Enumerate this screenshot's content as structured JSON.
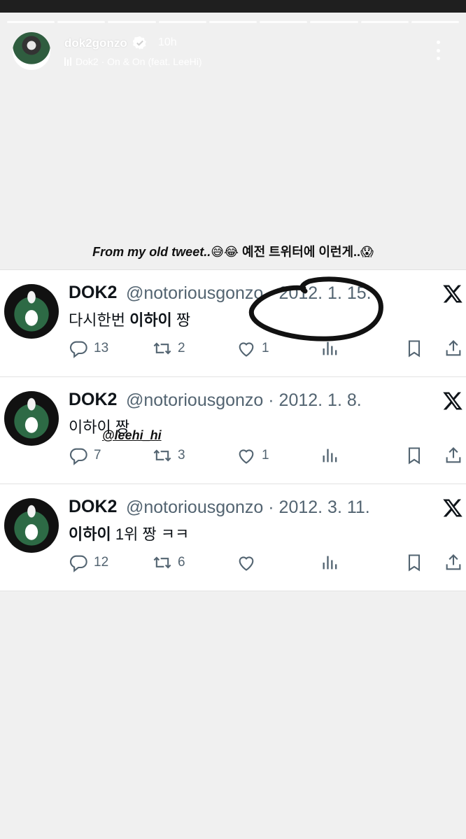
{
  "story": {
    "username": "dok2gonzo",
    "time_ago": "10h",
    "music": "Dok2 · On & On (feat. LeeHi)",
    "caption_en": "From my old tweet..",
    "caption_emojis": "😅😂",
    "caption_ko": "예전 트위터에 이런게..",
    "caption_end_emoji": "😱",
    "sticker_mention": "@leehi_hi"
  },
  "tweets": [
    {
      "name": "DOK2",
      "handle": "@notoriousgonzo · 2012. 1. 15.",
      "text_plain": "다시한번 ",
      "text_bold": "이하이",
      "text_after": " 짱",
      "replies": "13",
      "retweets": "2",
      "likes": "1"
    },
    {
      "name": "DOK2",
      "handle": "@notoriousgonzo · 2012. 1. 8.",
      "text_plain": "",
      "text_bold": "이하이",
      "text_after": " 짱",
      "replies": "7",
      "retweets": "3",
      "likes": "1"
    },
    {
      "name": "DOK2",
      "handle": "@notoriousgonzo · 2012. 3. 11.",
      "text_plain": "",
      "text_bold": "이하이",
      "text_after": " 1위 짱 ㅋㅋ",
      "replies": "12",
      "retweets": "6",
      "likes": ""
    }
  ],
  "icons": {
    "verified": "verified-badge-icon",
    "more": "more-options-icon",
    "x_logo": "x-logo-icon",
    "reply": "reply-icon",
    "retweet": "retweet-icon",
    "like": "heart-icon",
    "views": "views-icon",
    "bookmark": "bookmark-icon",
    "share": "share-icon"
  },
  "colors": {
    "story_bg": "#f0f0f0",
    "tweet_text": "#0f1419",
    "tweet_meta": "#536471"
  }
}
